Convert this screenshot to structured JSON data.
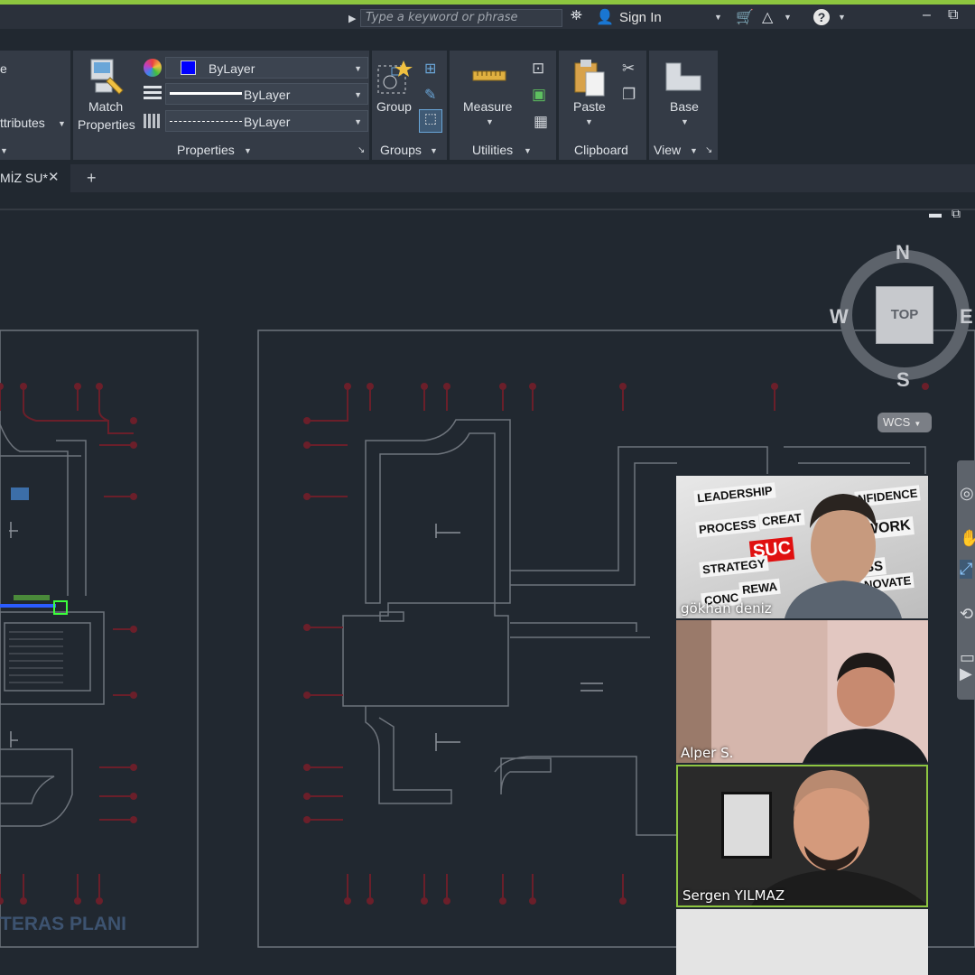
{
  "titlebar": {
    "search_placeholder": "Type a keyword or phrase",
    "sign_in": "Sign In"
  },
  "ribbon": {
    "attributes_label": "ttributes",
    "match_properties": {
      "line1": "Match",
      "line2": "Properties"
    },
    "properties": {
      "color": "ByLayer",
      "lineweight": "ByLayer",
      "linetype": "ByLayer",
      "title": "Properties"
    },
    "groups": {
      "group_label": "Group",
      "title": "Groups"
    },
    "utilities": {
      "measure_label": "Measure",
      "title": "Utilities"
    },
    "clipboard": {
      "paste_label": "Paste",
      "title": "Clipboard"
    },
    "view": {
      "base_label": "Base",
      "title": "View"
    }
  },
  "tabs": {
    "document_tab": "MİZ SU*"
  },
  "viewcube": {
    "north": "N",
    "south": "S",
    "west": "W",
    "east": "E",
    "top": "TOP",
    "wcs": "WCS"
  },
  "drawing": {
    "title_text": "TERAS PLANI"
  },
  "video": {
    "participants": [
      {
        "name": "gökhan deniz"
      },
      {
        "name": "Alper S."
      },
      {
        "name": "Sergen YILMAZ"
      }
    ],
    "background_words": [
      "LEADERSHIP",
      "PROCESS",
      "CREAT",
      "NFIDENCE",
      "WORK",
      "SUC",
      "STRATEGY",
      "ESS",
      "REWA",
      "NOVATE",
      "CONC"
    ]
  },
  "colors": {
    "accent_green": "#8dc63f",
    "canvas": "#212830",
    "ribbon": "#343b46",
    "drawing_lines": "#6e747c",
    "drawing_red": "#6b1f2a"
  }
}
